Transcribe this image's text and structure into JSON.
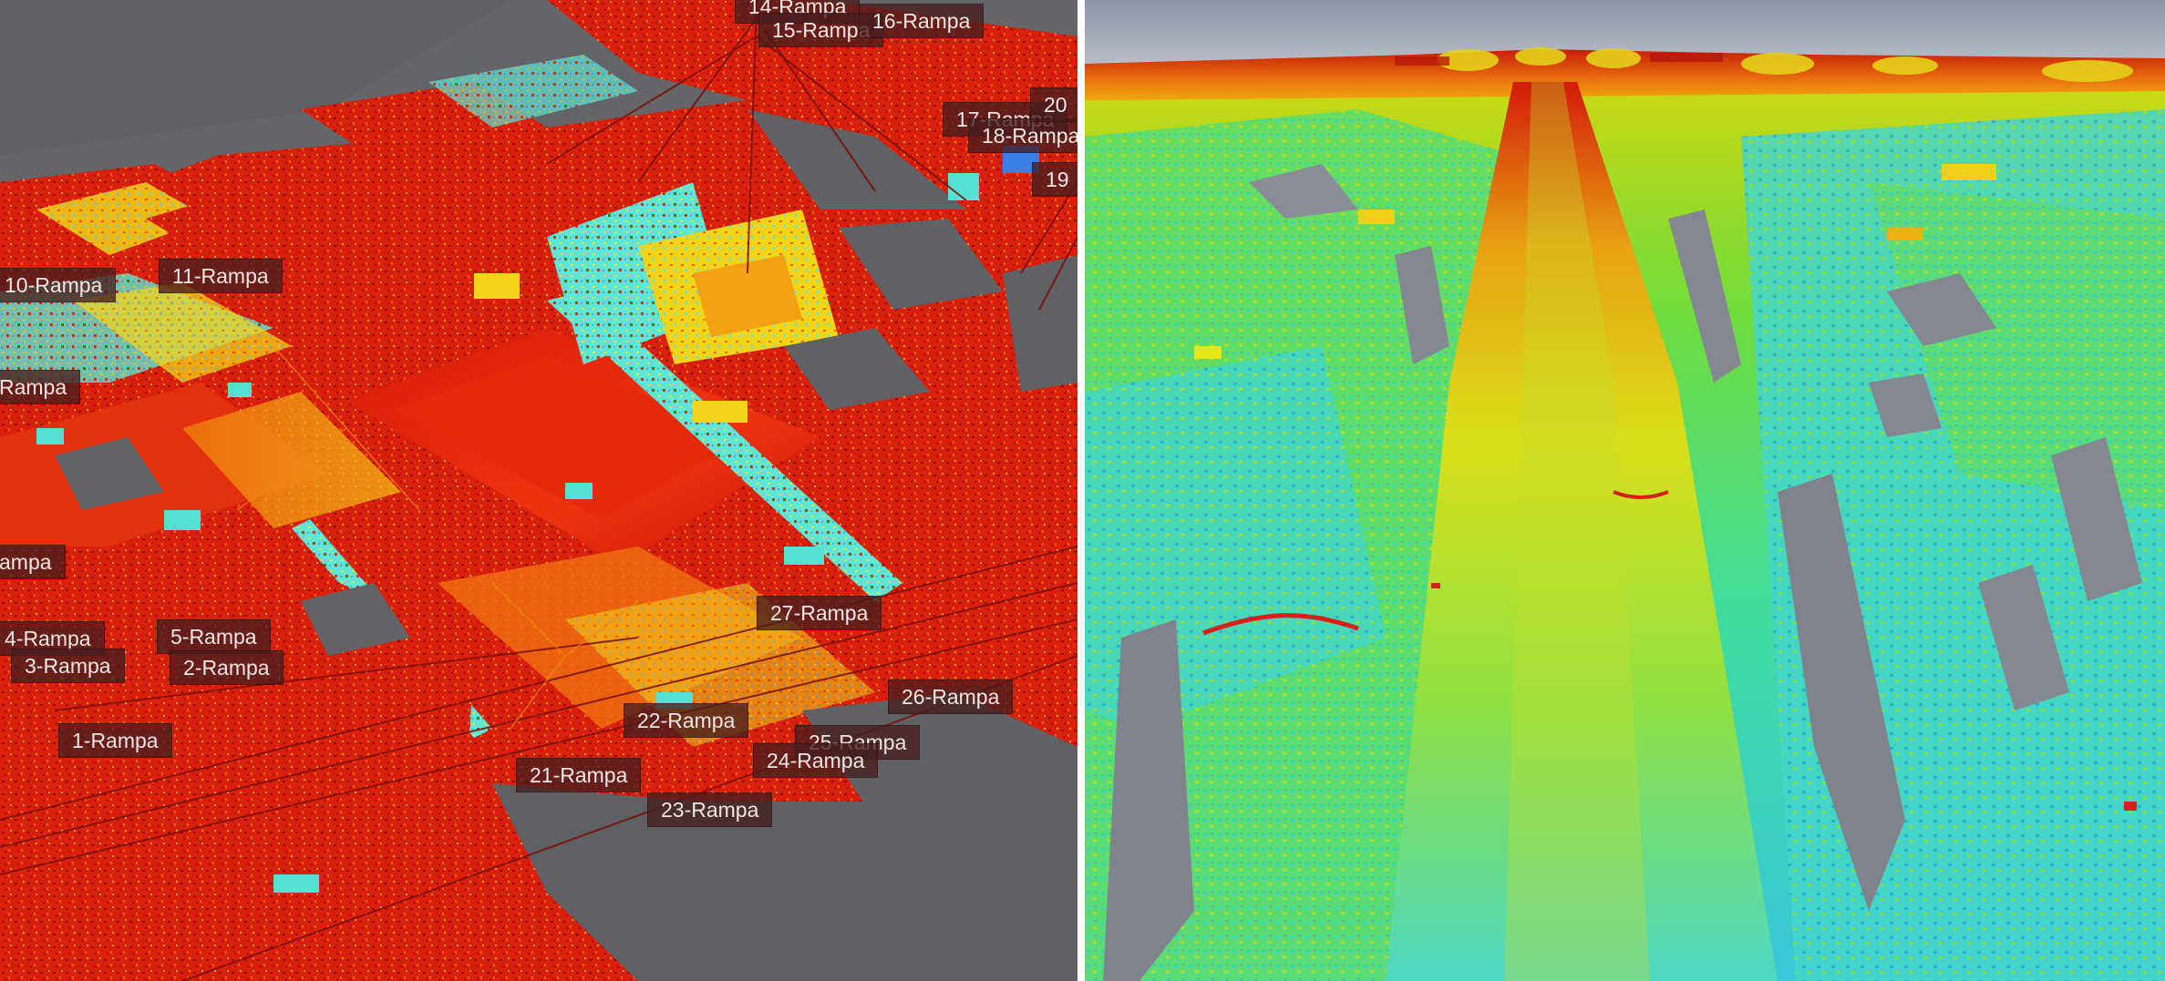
{
  "left_view": {
    "name": "point-cloud-urban",
    "labels": [
      {
        "id": "l14",
        "text": "14-Rampa"
      },
      {
        "id": "l15",
        "text": "15-Rampa"
      },
      {
        "id": "l16",
        "text": "16-Rampa"
      },
      {
        "id": "l17",
        "text": "17-Rampa"
      },
      {
        "id": "l18",
        "text": "18-Rampa"
      },
      {
        "id": "l19",
        "text": "19"
      },
      {
        "id": "l20",
        "text": "20"
      },
      {
        "id": "l10",
        "text": "10-Rampa"
      },
      {
        "id": "l11",
        "text": "11-Rampa"
      },
      {
        "id": "lr1",
        "text": "Rampa"
      },
      {
        "id": "lr2",
        "text": "ampa"
      },
      {
        "id": "l4",
        "text": "4-Rampa"
      },
      {
        "id": "l5",
        "text": "5-Rampa"
      },
      {
        "id": "l3",
        "text": "3-Rampa"
      },
      {
        "id": "l2",
        "text": "2-Rampa"
      },
      {
        "id": "l1",
        "text": "1-Rampa"
      },
      {
        "id": "l27",
        "text": "27-Rampa"
      },
      {
        "id": "l26",
        "text": "26-Rampa"
      },
      {
        "id": "l22",
        "text": "22-Rampa"
      },
      {
        "id": "l25",
        "text": "25-Rampa"
      },
      {
        "id": "l24",
        "text": "24-Rampa"
      },
      {
        "id": "l21",
        "text": "21-Rampa"
      },
      {
        "id": "l23",
        "text": "23-Rampa"
      }
    ]
  },
  "right_view": {
    "name": "point-cloud-terrain-road"
  },
  "colors": {
    "hot_red": "#e51b0a",
    "orange": "#f5700c",
    "yellow": "#f4e514",
    "cyan": "#4fe0d0",
    "green": "#7fd64a",
    "gray_bg": "#65676a",
    "label_bg": "#461e1e",
    "label_text": "#f1e6e3"
  }
}
